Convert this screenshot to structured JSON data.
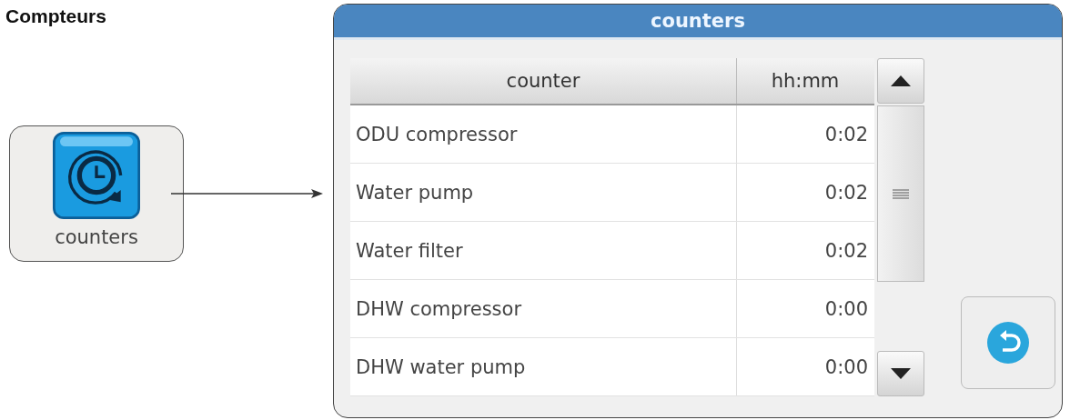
{
  "heading": "Compteurs",
  "tile": {
    "label": "counters"
  },
  "dialog": {
    "title": "counters",
    "columns": [
      "counter",
      "hh:mm"
    ],
    "rows": [
      {
        "counter": "ODU compressor",
        "time": "0:02"
      },
      {
        "counter": "Water pump",
        "time": "0:02"
      },
      {
        "counter": "Water filter",
        "time": "0:02"
      },
      {
        "counter": "DHW compressor",
        "time": "0:00"
      },
      {
        "counter": "DHW water pump",
        "time": "0:00"
      }
    ]
  }
}
